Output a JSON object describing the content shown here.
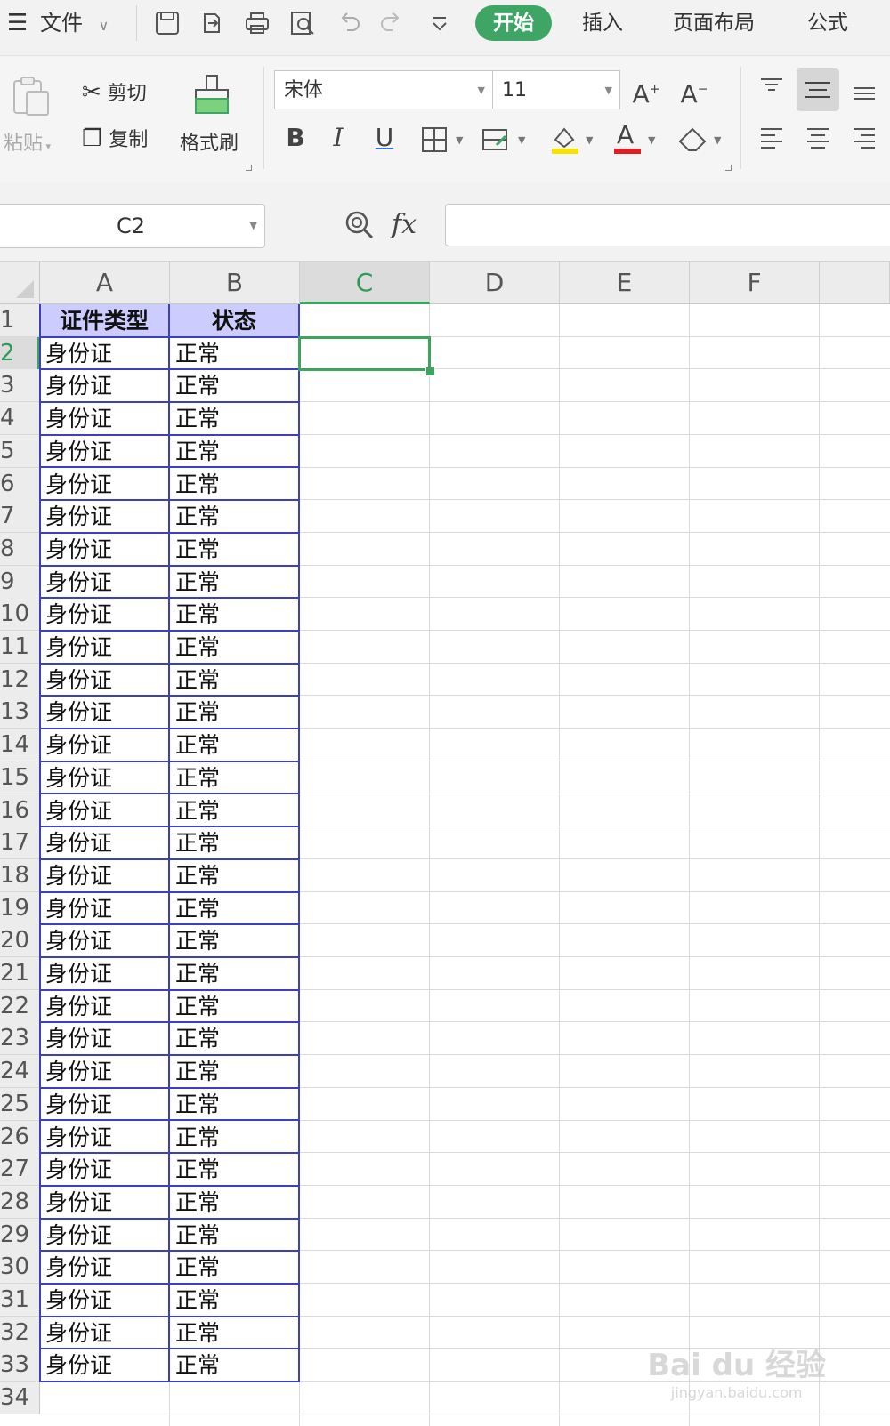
{
  "menubar": {
    "file_label": "文件",
    "tabs": [
      {
        "label": "开始",
        "active": true
      },
      {
        "label": "插入",
        "active": false
      },
      {
        "label": "页面布局",
        "active": false
      },
      {
        "label": "公式",
        "active": false
      }
    ],
    "quick_icons": [
      "save-icon",
      "export-icon",
      "print-icon",
      "print-preview-icon",
      "undo-icon",
      "redo-icon",
      "customize-icon"
    ]
  },
  "ribbon": {
    "paste_label": "粘贴",
    "cut_label": "剪切",
    "copy_label": "复制",
    "format_painter_label": "格式刷",
    "font_name": "宋体",
    "font_size": "11",
    "accent_color": "#3fa565",
    "font_color": "#e02020",
    "highlight_color": "#f5e200"
  },
  "formula_bar": {
    "name_box": "C2",
    "fx_label": "fx",
    "formula": ""
  },
  "sheet": {
    "columns": [
      "A",
      "B",
      "C",
      "D",
      "E",
      "F"
    ],
    "selected_column": "C",
    "selected_row": 2,
    "header_row": [
      "证件类型",
      "状态"
    ],
    "rows": [
      [
        "身份证",
        "正常"
      ],
      [
        "身份证",
        "正常"
      ],
      [
        "身份证",
        "正常"
      ],
      [
        "身份证",
        "正常"
      ],
      [
        "身份证",
        "正常"
      ],
      [
        "身份证",
        "正常"
      ],
      [
        "身份证",
        "正常"
      ],
      [
        "身份证",
        "正常"
      ],
      [
        "身份证",
        "正常"
      ],
      [
        "身份证",
        "正常"
      ],
      [
        "身份证",
        "正常"
      ],
      [
        "身份证",
        "正常"
      ],
      [
        "身份证",
        "正常"
      ],
      [
        "身份证",
        "正常"
      ],
      [
        "身份证",
        "正常"
      ],
      [
        "身份证",
        "正常"
      ],
      [
        "身份证",
        "正常"
      ],
      [
        "身份证",
        "正常"
      ],
      [
        "身份证",
        "正常"
      ],
      [
        "身份证",
        "正常"
      ],
      [
        "身份证",
        "正常"
      ],
      [
        "身份证",
        "正常"
      ],
      [
        "身份证",
        "正常"
      ],
      [
        "身份证",
        "正常"
      ],
      [
        "身份证",
        "正常"
      ],
      [
        "身份证",
        "正常"
      ],
      [
        "身份证",
        "正常"
      ],
      [
        "身份证",
        "正常"
      ],
      [
        "身份证",
        "正常"
      ],
      [
        "身份证",
        "正常"
      ],
      [
        "身份证",
        "正常"
      ],
      [
        "身份证",
        "正常"
      ]
    ],
    "row_numbers": [
      "1",
      "2",
      "3",
      "4",
      "5",
      "6",
      "7",
      "8",
      "9",
      "10",
      "11",
      "12",
      "13",
      "14",
      "15",
      "16",
      "17",
      "18",
      "19",
      "20",
      "21",
      "22",
      "23",
      "24",
      "25",
      "26",
      "27",
      "28",
      "29",
      "30",
      "31",
      "32",
      "33",
      "34"
    ],
    "header_fill": "#ccccff",
    "border_color": "#3b3fc0"
  },
  "watermark": {
    "text": "Bai du 经验",
    "sub": "jingyan.baidu.com"
  }
}
